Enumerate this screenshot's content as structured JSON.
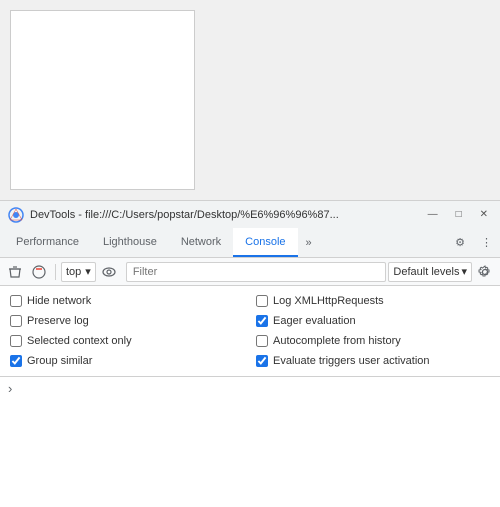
{
  "preview": {
    "label": "preview-area"
  },
  "titlebar": {
    "title": "DevTools - file:///C:/Users/popstar/Desktop/%E6%96%96%87...",
    "minimize": "—",
    "maximize": "□",
    "close": "✕"
  },
  "tabs": {
    "items": [
      {
        "label": "Performance",
        "active": false
      },
      {
        "label": "Lighthouse",
        "active": false
      },
      {
        "label": "Network",
        "active": false
      },
      {
        "label": "Console",
        "active": true
      }
    ],
    "more_icon": "»",
    "settings_icon": "⚙",
    "dots_icon": "⋮"
  },
  "toolbar": {
    "clear_icon": "🚫",
    "filter_icon": "⊘",
    "context_value": "top",
    "context_arrow": "▾",
    "eye_icon": "👁",
    "filter_placeholder": "Filter",
    "level_label": "Default levels",
    "level_arrow": "▾",
    "settings_icon": "⚙"
  },
  "checkboxes": {
    "col1": [
      {
        "id": "hide-network",
        "label": "Hide network",
        "checked": false
      },
      {
        "id": "preserve-log",
        "label": "Preserve log",
        "checked": false
      },
      {
        "id": "selected-context",
        "label": "Selected context only",
        "checked": false
      },
      {
        "id": "group-similar",
        "label": "Group similar",
        "checked": true
      }
    ],
    "col2": [
      {
        "id": "log-xml",
        "label": "Log XMLHttpRequests",
        "checked": false
      },
      {
        "id": "eager-eval",
        "label": "Eager evaluation",
        "checked": true
      },
      {
        "id": "autocomplete-history",
        "label": "Autocomplete from history",
        "checked": false
      },
      {
        "id": "eval-triggers",
        "label": "Evaluate triggers user activation",
        "checked": true
      }
    ]
  },
  "console": {
    "prompt": "›"
  }
}
